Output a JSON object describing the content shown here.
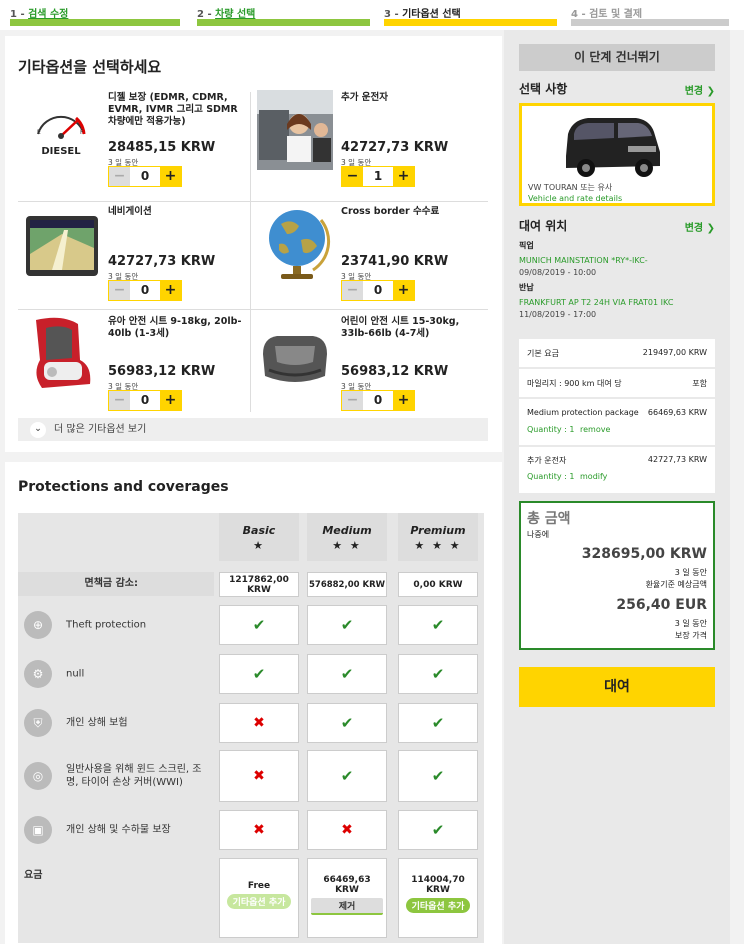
{
  "steps": [
    {
      "num": "1 -",
      "label": "검색 수정"
    },
    {
      "num": "2 -",
      "label": "차량 선택"
    },
    {
      "num": "3 -",
      "label": "기타옵션 선택"
    },
    {
      "num": "4 -",
      "label": "검토 및 결제"
    }
  ],
  "options": {
    "title": "기타옵션을 선택하세요",
    "items": [
      {
        "name": "디젤 보장 (EDMR, CDMR, EVMR, IVMR 그리고 SDMR 차량에만 적용가능)",
        "price": "28485,15 KRW",
        "days": "3 일 동안",
        "qty": "0",
        "icon": "diesel-gauge-icon",
        "icon_label": "DIESEL"
      },
      {
        "name": "추가 운전자",
        "price": "42727,73 KRW",
        "days": "3 일 동안",
        "qty": "1",
        "icon": "driver-photo"
      },
      {
        "name": "네비게이션",
        "price": "42727,73 KRW",
        "days": "3 일 동안",
        "qty": "0",
        "icon": "gps-device-icon"
      },
      {
        "name": "Cross border 수수료",
        "price": "23741,90 KRW",
        "days": "3 일 동안",
        "qty": "0",
        "icon": "globe-icon"
      },
      {
        "name": "유아 안전 시트 9-18kg, 20lb-40lb (1-3세)",
        "price": "56983,12 KRW",
        "days": "3 일 동안",
        "qty": "0",
        "icon": "child-seat-icon"
      },
      {
        "name": "어린이 안전 시트 15-30kg, 33lb-66lb (4-7세)",
        "price": "56983,12 KRW",
        "days": "3 일 동안",
        "qty": "0",
        "icon": "booster-seat-icon"
      }
    ],
    "more_label": "더 많은 기타옵션 보기"
  },
  "protections": {
    "title": "Protections and coverages",
    "columns": [
      {
        "name": "Basic",
        "stars": "★"
      },
      {
        "name": "Medium",
        "stars": "★ ★"
      },
      {
        "name": "Premium",
        "stars": "★ ★ ★"
      }
    ],
    "excess_label": "면책금 감소:",
    "excess": [
      "1217862,00 KRW",
      "576882,00 KRW",
      "0,00 KRW"
    ],
    "rows": [
      {
        "label": "Theft protection",
        "icon": "steering-lock-icon",
        "values": [
          true,
          true,
          true
        ]
      },
      {
        "label": "null",
        "icon": "car-damage-icon",
        "values": [
          true,
          true,
          true
        ]
      },
      {
        "label": "개인 상해 보험",
        "icon": "seatbelt-icon",
        "values": [
          false,
          true,
          true
        ]
      },
      {
        "label": "일반사용을 위해 윈드 스크린, 조명, 타이어 손상 커버(WWI)",
        "icon": "tire-icon",
        "values": [
          false,
          true,
          true
        ]
      },
      {
        "label": "개인 상해 및 수하물 보장",
        "icon": "luggage-icon",
        "values": [
          false,
          false,
          true
        ]
      }
    ],
    "fee_label": "요금",
    "fees": [
      {
        "price": "Free",
        "action": "기타옵션 추가"
      },
      {
        "price": "66469,63 KRW",
        "action": "제거"
      },
      {
        "price": "114004,70 KRW",
        "action": "기타옵션 추가"
      }
    ]
  },
  "sidebar": {
    "skip": "이 단계 건너뛰기",
    "selection_title": "선택 사항",
    "change": "변경",
    "car_name": "VW TOURAN 또는 유사",
    "car_link": "Vehicle and rate details",
    "location_title": "대여 위치",
    "pickup_label": "픽업",
    "pickup_loc": "MUNICH MAINSTATION *RY*-IKC-",
    "pickup_time": "09/08/2019 - 10:00",
    "return_label": "반납",
    "return_loc": "FRANKFURT AP T2 24H VIA FRAT01 IKC",
    "return_time": "11/08/2019 - 17:00",
    "prices": [
      {
        "label": "기본 요금",
        "value": "219497,00 KRW"
      },
      {
        "label": "마일리지 : 900 km 대여 당",
        "value": "포함"
      }
    ],
    "extras": [
      {
        "label": "Medium protection package",
        "value": "66469,63 KRW",
        "qty": "Quantity : 1",
        "action": "remove"
      },
      {
        "label": "추가 운전자",
        "value": "42727,73 KRW",
        "qty": "Quantity : 1",
        "action": "modify"
      }
    ],
    "total_title": "총 금액",
    "total_sub": "나중에",
    "total_krw": "328695,00 KRW",
    "total_days": "3 일 동안",
    "total_note": "환율기준 예상금액",
    "total_eur": "256,40 EUR",
    "total_days2": "3 일 동안",
    "total_note2": "보장 가격",
    "book": "대여"
  },
  "colors": {
    "green": "#2a9b2a",
    "yellow": "#ffd400",
    "lightgreen": "#8dc63f"
  }
}
